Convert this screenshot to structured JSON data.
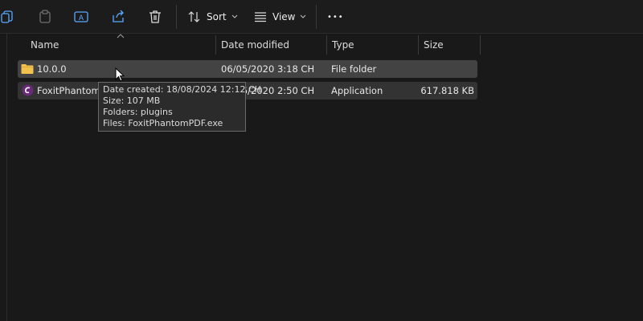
{
  "toolbar": {
    "icons": [
      "copy-icon",
      "paste-icon",
      "rename-icon",
      "share-icon",
      "delete-icon"
    ],
    "sort_label": "Sort",
    "view_label": "View",
    "more_label": "•••"
  },
  "columns": {
    "name": "Name",
    "date_modified": "Date modified",
    "type": "Type",
    "size": "Size"
  },
  "rows": [
    {
      "name": "10.0.0",
      "date_modified": "06/05/2020 3:18 CH",
      "type": "File folder",
      "size": "",
      "icon": "folder-icon"
    },
    {
      "name": "FoxitPhantomPDF.exe",
      "date_modified": "06/05/2020 2:50 CH",
      "type": "Application",
      "size": "617.818 KB",
      "icon": "foxit-app-icon"
    }
  ],
  "tooltip": {
    "date_created": "Date created: 18/08/2024 12:12 CH",
    "size": "Size: 107 MB",
    "folders": "Folders: plugins",
    "files": "Files: FoxitPhantomPDF.exe"
  },
  "colors": {
    "background": "#191919",
    "selected_row": "#434343",
    "hover_row": "#333333",
    "folder": "#f2c14e",
    "foxit": "#6a2a7a"
  }
}
